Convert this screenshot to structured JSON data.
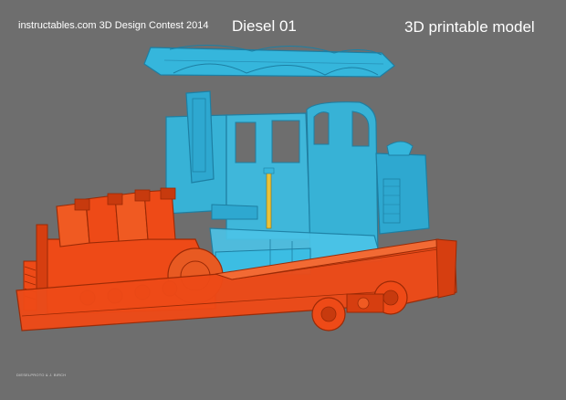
{
  "header": {
    "contest": "instructables.com 3D Design Contest 2014",
    "title": "Diesel 01",
    "subtitle": "3D printable model"
  },
  "footer": {
    "credit": "DIESELPROTO & J. BIRCH"
  },
  "colors": {
    "background": "#6e6e6e",
    "cab": "#35b6dc",
    "cab_edge": "#1d7fa3",
    "chassis": "#ee4a17",
    "chassis_edge": "#9a2a06",
    "text": "#ffffff"
  },
  "render": {
    "subject": "exploded-view-locomotive-model",
    "parts": [
      "roof-panel",
      "driver-cab",
      "engine-block",
      "chassis-frame",
      "wheel-set"
    ]
  }
}
